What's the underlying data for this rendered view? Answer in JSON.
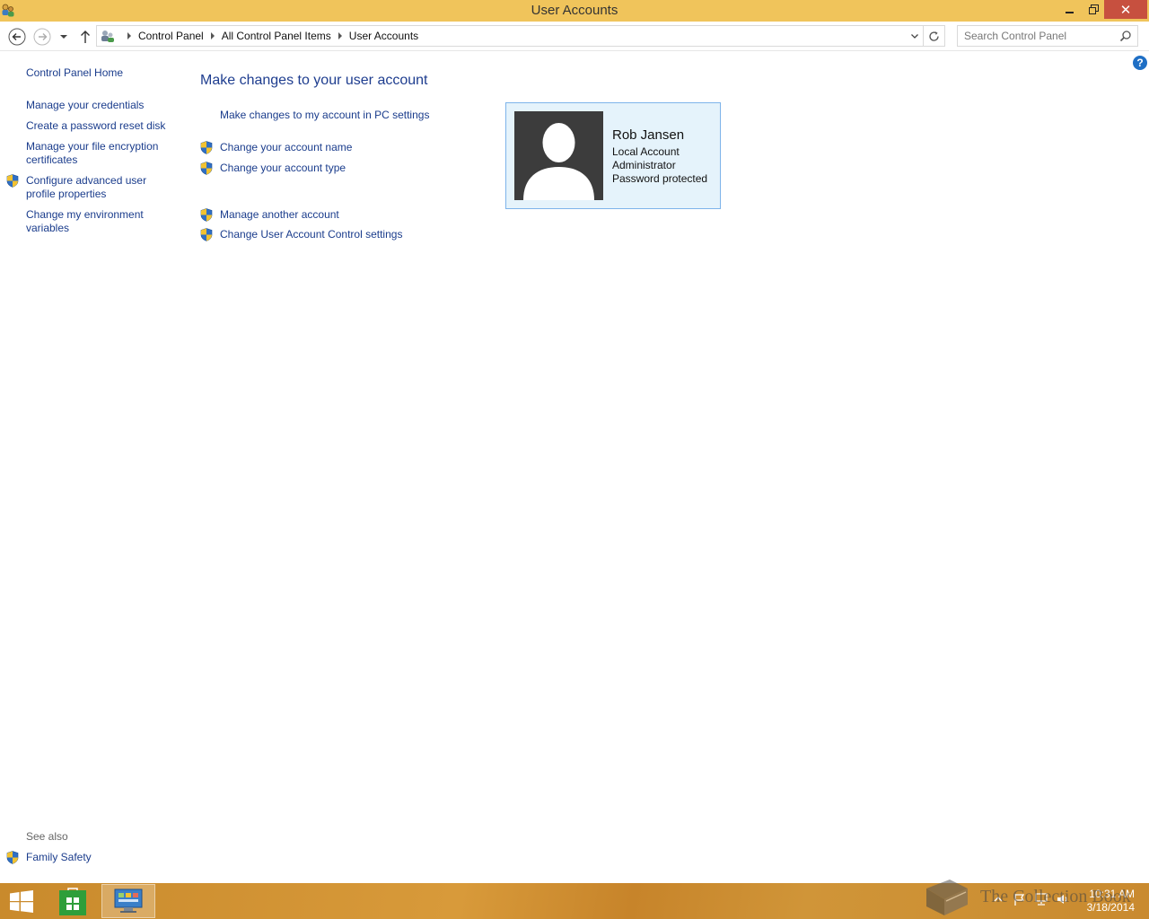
{
  "window": {
    "title": "User Accounts",
    "close_glyph": "✕"
  },
  "nav": {
    "breadcrumbs": [
      "Control Panel",
      "All Control Panel Items",
      "User Accounts"
    ],
    "search_placeholder": "Search Control Panel"
  },
  "help": {
    "label": "?"
  },
  "left_pane": {
    "home": "Control Panel Home",
    "links": [
      "Manage your credentials",
      "Create a password reset disk",
      "Manage your file encryption certificates",
      "Configure advanced user profile properties",
      "Change my environment variables"
    ],
    "see_also_label": "See also",
    "see_also": [
      "Family Safety"
    ]
  },
  "main": {
    "title": "Make changes to your user account",
    "tasks": [
      "Make changes to my account in PC settings",
      "Change your account name",
      "Change your account type",
      "Manage another account",
      "Change User Account Control settings"
    ]
  },
  "account": {
    "name": "Rob Jansen",
    "type": "Local Account",
    "role": "Administrator",
    "password": "Password protected"
  },
  "taskbar": {
    "clock_time": "10:31 AM",
    "clock_date": "3/18/2014"
  },
  "watermark": {
    "text": "The Collection Book"
  },
  "colors": {
    "titlebar": "#f0c45b",
    "link": "#1a3c8c",
    "card_bg": "#e5f3fb",
    "card_border": "#7eb4ea",
    "close_button": "#c7503f"
  }
}
